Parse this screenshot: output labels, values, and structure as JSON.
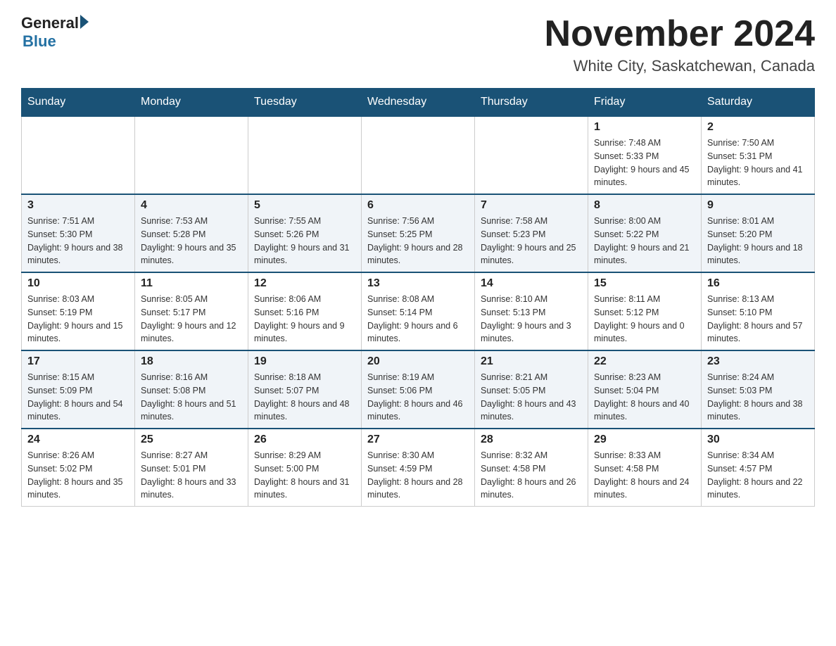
{
  "logo": {
    "general": "General",
    "blue": "Blue"
  },
  "title": "November 2024",
  "location": "White City, Saskatchewan, Canada",
  "days_of_week": [
    "Sunday",
    "Monday",
    "Tuesday",
    "Wednesday",
    "Thursday",
    "Friday",
    "Saturday"
  ],
  "weeks": [
    [
      {
        "day": "",
        "info": ""
      },
      {
        "day": "",
        "info": ""
      },
      {
        "day": "",
        "info": ""
      },
      {
        "day": "",
        "info": ""
      },
      {
        "day": "",
        "info": ""
      },
      {
        "day": "1",
        "info": "Sunrise: 7:48 AM\nSunset: 5:33 PM\nDaylight: 9 hours and 45 minutes."
      },
      {
        "day": "2",
        "info": "Sunrise: 7:50 AM\nSunset: 5:31 PM\nDaylight: 9 hours and 41 minutes."
      }
    ],
    [
      {
        "day": "3",
        "info": "Sunrise: 7:51 AM\nSunset: 5:30 PM\nDaylight: 9 hours and 38 minutes."
      },
      {
        "day": "4",
        "info": "Sunrise: 7:53 AM\nSunset: 5:28 PM\nDaylight: 9 hours and 35 minutes."
      },
      {
        "day": "5",
        "info": "Sunrise: 7:55 AM\nSunset: 5:26 PM\nDaylight: 9 hours and 31 minutes."
      },
      {
        "day": "6",
        "info": "Sunrise: 7:56 AM\nSunset: 5:25 PM\nDaylight: 9 hours and 28 minutes."
      },
      {
        "day": "7",
        "info": "Sunrise: 7:58 AM\nSunset: 5:23 PM\nDaylight: 9 hours and 25 minutes."
      },
      {
        "day": "8",
        "info": "Sunrise: 8:00 AM\nSunset: 5:22 PM\nDaylight: 9 hours and 21 minutes."
      },
      {
        "day": "9",
        "info": "Sunrise: 8:01 AM\nSunset: 5:20 PM\nDaylight: 9 hours and 18 minutes."
      }
    ],
    [
      {
        "day": "10",
        "info": "Sunrise: 8:03 AM\nSunset: 5:19 PM\nDaylight: 9 hours and 15 minutes."
      },
      {
        "day": "11",
        "info": "Sunrise: 8:05 AM\nSunset: 5:17 PM\nDaylight: 9 hours and 12 minutes."
      },
      {
        "day": "12",
        "info": "Sunrise: 8:06 AM\nSunset: 5:16 PM\nDaylight: 9 hours and 9 minutes."
      },
      {
        "day": "13",
        "info": "Sunrise: 8:08 AM\nSunset: 5:14 PM\nDaylight: 9 hours and 6 minutes."
      },
      {
        "day": "14",
        "info": "Sunrise: 8:10 AM\nSunset: 5:13 PM\nDaylight: 9 hours and 3 minutes."
      },
      {
        "day": "15",
        "info": "Sunrise: 8:11 AM\nSunset: 5:12 PM\nDaylight: 9 hours and 0 minutes."
      },
      {
        "day": "16",
        "info": "Sunrise: 8:13 AM\nSunset: 5:10 PM\nDaylight: 8 hours and 57 minutes."
      }
    ],
    [
      {
        "day": "17",
        "info": "Sunrise: 8:15 AM\nSunset: 5:09 PM\nDaylight: 8 hours and 54 minutes."
      },
      {
        "day": "18",
        "info": "Sunrise: 8:16 AM\nSunset: 5:08 PM\nDaylight: 8 hours and 51 minutes."
      },
      {
        "day": "19",
        "info": "Sunrise: 8:18 AM\nSunset: 5:07 PM\nDaylight: 8 hours and 48 minutes."
      },
      {
        "day": "20",
        "info": "Sunrise: 8:19 AM\nSunset: 5:06 PM\nDaylight: 8 hours and 46 minutes."
      },
      {
        "day": "21",
        "info": "Sunrise: 8:21 AM\nSunset: 5:05 PM\nDaylight: 8 hours and 43 minutes."
      },
      {
        "day": "22",
        "info": "Sunrise: 8:23 AM\nSunset: 5:04 PM\nDaylight: 8 hours and 40 minutes."
      },
      {
        "day": "23",
        "info": "Sunrise: 8:24 AM\nSunset: 5:03 PM\nDaylight: 8 hours and 38 minutes."
      }
    ],
    [
      {
        "day": "24",
        "info": "Sunrise: 8:26 AM\nSunset: 5:02 PM\nDaylight: 8 hours and 35 minutes."
      },
      {
        "day": "25",
        "info": "Sunrise: 8:27 AM\nSunset: 5:01 PM\nDaylight: 8 hours and 33 minutes."
      },
      {
        "day": "26",
        "info": "Sunrise: 8:29 AM\nSunset: 5:00 PM\nDaylight: 8 hours and 31 minutes."
      },
      {
        "day": "27",
        "info": "Sunrise: 8:30 AM\nSunset: 4:59 PM\nDaylight: 8 hours and 28 minutes."
      },
      {
        "day": "28",
        "info": "Sunrise: 8:32 AM\nSunset: 4:58 PM\nDaylight: 8 hours and 26 minutes."
      },
      {
        "day": "29",
        "info": "Sunrise: 8:33 AM\nSunset: 4:58 PM\nDaylight: 8 hours and 24 minutes."
      },
      {
        "day": "30",
        "info": "Sunrise: 8:34 AM\nSunset: 4:57 PM\nDaylight: 8 hours and 22 minutes."
      }
    ]
  ]
}
